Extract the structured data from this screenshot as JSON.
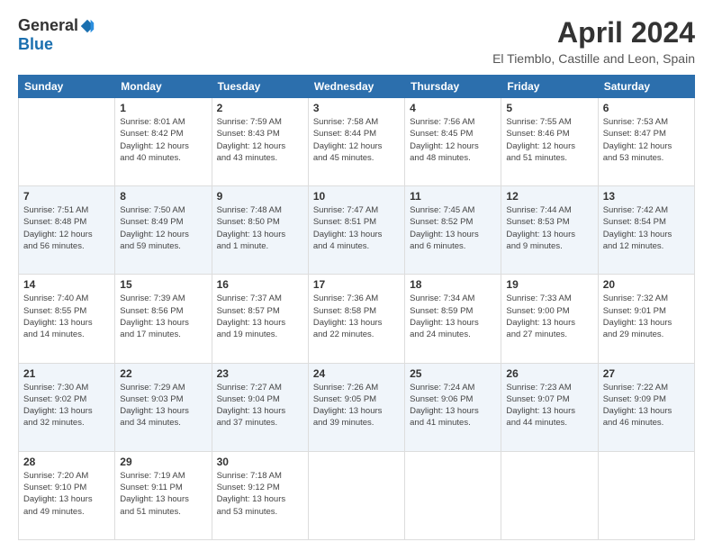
{
  "header": {
    "logo_general": "General",
    "logo_blue": "Blue",
    "title": "April 2024",
    "subtitle": "El Tiemblo, Castille and Leon, Spain"
  },
  "days_of_week": [
    "Sunday",
    "Monday",
    "Tuesday",
    "Wednesday",
    "Thursday",
    "Friday",
    "Saturday"
  ],
  "weeks": [
    [
      {
        "day": "",
        "info": ""
      },
      {
        "day": "1",
        "info": "Sunrise: 8:01 AM\nSunset: 8:42 PM\nDaylight: 12 hours\nand 40 minutes."
      },
      {
        "day": "2",
        "info": "Sunrise: 7:59 AM\nSunset: 8:43 PM\nDaylight: 12 hours\nand 43 minutes."
      },
      {
        "day": "3",
        "info": "Sunrise: 7:58 AM\nSunset: 8:44 PM\nDaylight: 12 hours\nand 45 minutes."
      },
      {
        "day": "4",
        "info": "Sunrise: 7:56 AM\nSunset: 8:45 PM\nDaylight: 12 hours\nand 48 minutes."
      },
      {
        "day": "5",
        "info": "Sunrise: 7:55 AM\nSunset: 8:46 PM\nDaylight: 12 hours\nand 51 minutes."
      },
      {
        "day": "6",
        "info": "Sunrise: 7:53 AM\nSunset: 8:47 PM\nDaylight: 12 hours\nand 53 minutes."
      }
    ],
    [
      {
        "day": "7",
        "info": "Sunrise: 7:51 AM\nSunset: 8:48 PM\nDaylight: 12 hours\nand 56 minutes."
      },
      {
        "day": "8",
        "info": "Sunrise: 7:50 AM\nSunset: 8:49 PM\nDaylight: 12 hours\nand 59 minutes."
      },
      {
        "day": "9",
        "info": "Sunrise: 7:48 AM\nSunset: 8:50 PM\nDaylight: 13 hours\nand 1 minute."
      },
      {
        "day": "10",
        "info": "Sunrise: 7:47 AM\nSunset: 8:51 PM\nDaylight: 13 hours\nand 4 minutes."
      },
      {
        "day": "11",
        "info": "Sunrise: 7:45 AM\nSunset: 8:52 PM\nDaylight: 13 hours\nand 6 minutes."
      },
      {
        "day": "12",
        "info": "Sunrise: 7:44 AM\nSunset: 8:53 PM\nDaylight: 13 hours\nand 9 minutes."
      },
      {
        "day": "13",
        "info": "Sunrise: 7:42 AM\nSunset: 8:54 PM\nDaylight: 13 hours\nand 12 minutes."
      }
    ],
    [
      {
        "day": "14",
        "info": "Sunrise: 7:40 AM\nSunset: 8:55 PM\nDaylight: 13 hours\nand 14 minutes."
      },
      {
        "day": "15",
        "info": "Sunrise: 7:39 AM\nSunset: 8:56 PM\nDaylight: 13 hours\nand 17 minutes."
      },
      {
        "day": "16",
        "info": "Sunrise: 7:37 AM\nSunset: 8:57 PM\nDaylight: 13 hours\nand 19 minutes."
      },
      {
        "day": "17",
        "info": "Sunrise: 7:36 AM\nSunset: 8:58 PM\nDaylight: 13 hours\nand 22 minutes."
      },
      {
        "day": "18",
        "info": "Sunrise: 7:34 AM\nSunset: 8:59 PM\nDaylight: 13 hours\nand 24 minutes."
      },
      {
        "day": "19",
        "info": "Sunrise: 7:33 AM\nSunset: 9:00 PM\nDaylight: 13 hours\nand 27 minutes."
      },
      {
        "day": "20",
        "info": "Sunrise: 7:32 AM\nSunset: 9:01 PM\nDaylight: 13 hours\nand 29 minutes."
      }
    ],
    [
      {
        "day": "21",
        "info": "Sunrise: 7:30 AM\nSunset: 9:02 PM\nDaylight: 13 hours\nand 32 minutes."
      },
      {
        "day": "22",
        "info": "Sunrise: 7:29 AM\nSunset: 9:03 PM\nDaylight: 13 hours\nand 34 minutes."
      },
      {
        "day": "23",
        "info": "Sunrise: 7:27 AM\nSunset: 9:04 PM\nDaylight: 13 hours\nand 37 minutes."
      },
      {
        "day": "24",
        "info": "Sunrise: 7:26 AM\nSunset: 9:05 PM\nDaylight: 13 hours\nand 39 minutes."
      },
      {
        "day": "25",
        "info": "Sunrise: 7:24 AM\nSunset: 9:06 PM\nDaylight: 13 hours\nand 41 minutes."
      },
      {
        "day": "26",
        "info": "Sunrise: 7:23 AM\nSunset: 9:07 PM\nDaylight: 13 hours\nand 44 minutes."
      },
      {
        "day": "27",
        "info": "Sunrise: 7:22 AM\nSunset: 9:09 PM\nDaylight: 13 hours\nand 46 minutes."
      }
    ],
    [
      {
        "day": "28",
        "info": "Sunrise: 7:20 AM\nSunset: 9:10 PM\nDaylight: 13 hours\nand 49 minutes."
      },
      {
        "day": "29",
        "info": "Sunrise: 7:19 AM\nSunset: 9:11 PM\nDaylight: 13 hours\nand 51 minutes."
      },
      {
        "day": "30",
        "info": "Sunrise: 7:18 AM\nSunset: 9:12 PM\nDaylight: 13 hours\nand 53 minutes."
      },
      {
        "day": "",
        "info": ""
      },
      {
        "day": "",
        "info": ""
      },
      {
        "day": "",
        "info": ""
      },
      {
        "day": "",
        "info": ""
      }
    ]
  ]
}
